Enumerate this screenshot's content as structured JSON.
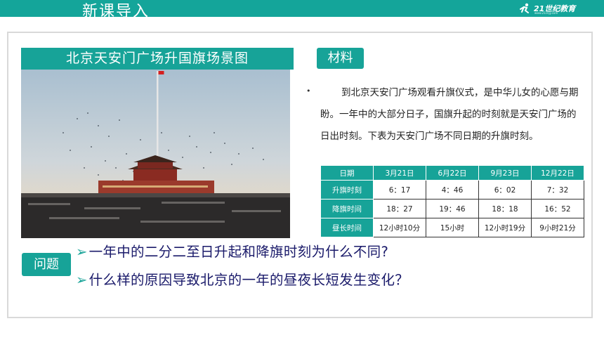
{
  "header": {
    "title": "新课导入",
    "logo_text": "21世纪教育",
    "logo_sub": "www.21cnjy.com"
  },
  "image_panel": {
    "title": "北京天安门广场升国旗场景图"
  },
  "material": {
    "tag": "材料",
    "bullet": "•",
    "text": "到北京天安门广场观看升旗仪式，是中华儿女的心愿与期盼。一年中的大部分日子，国旗升起的时刻就是天安门广场的日出时刻。下表为天安门广场不同日期的升旗时刻。"
  },
  "table": {
    "headers": [
      "日期",
      "3月21日",
      "6月22日",
      "9月23日",
      "12月22日"
    ],
    "rows": [
      {
        "label": "升旗时刻",
        "values": [
          "6：17",
          "4：46",
          "6：02",
          "7：32"
        ]
      },
      {
        "label": "降旗时间",
        "values": [
          "18：27",
          "19：46",
          "18：18",
          "16：52"
        ]
      },
      {
        "label": "昼长时间",
        "values": [
          "12小时10分",
          "15小时",
          "12小时19分",
          "9小时21分"
        ]
      }
    ]
  },
  "questions": {
    "tag": "问题",
    "arrow": "➢",
    "q1": "一年中的二分二至日升起和降旗时刻为什么不同?",
    "q2": "什么样的原因导致北京的一年的昼夜长短发生变化？"
  },
  "colors": {
    "accent": "#17a398",
    "question_text": "#1a1a6a"
  }
}
